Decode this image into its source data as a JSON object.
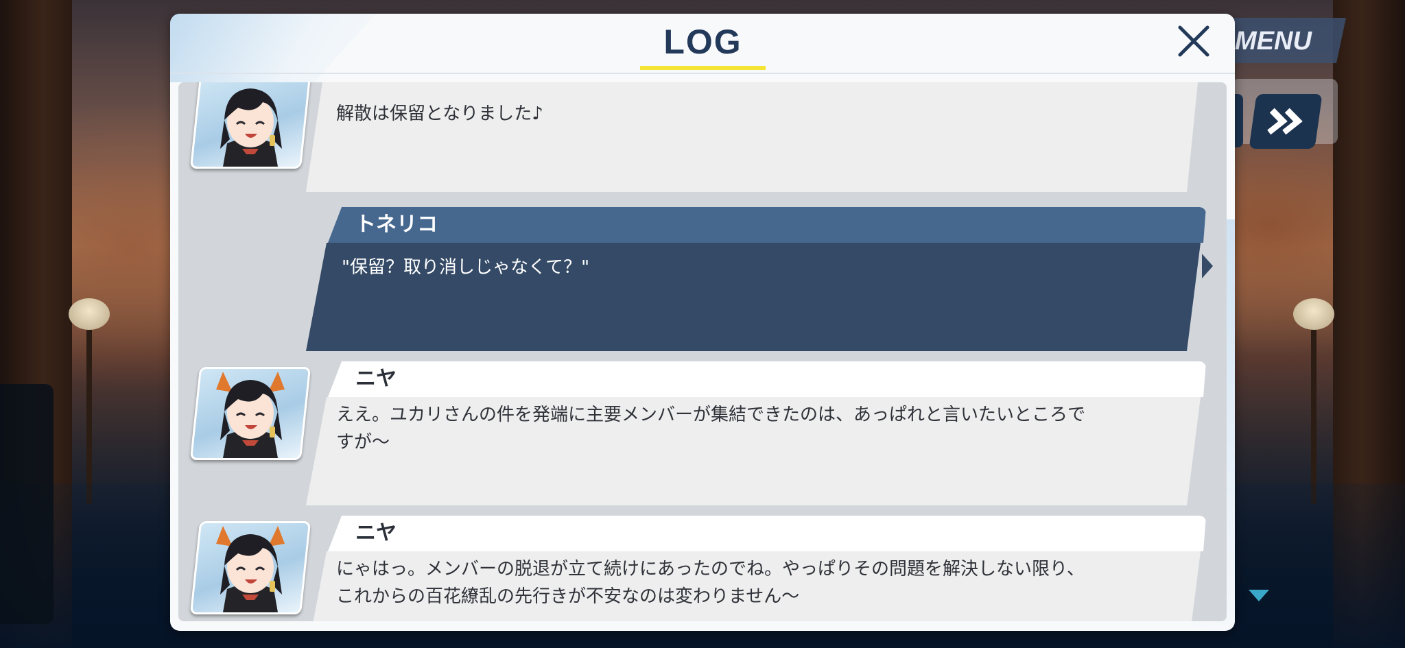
{
  "menu": {
    "label": "MENU"
  },
  "log": {
    "title": "LOG",
    "entries": [
      {
        "speaker": "",
        "text": "解散は保留となりました♪",
        "has_avatar": true
      },
      {
        "speaker": "トネリコ",
        "text": "\"保留？取り消しじゃなくて？\"",
        "has_avatar": false,
        "selected": true
      },
      {
        "speaker": "ニヤ",
        "text": "ええ。ユカリさんの件を発端に主要メンバーが集結できたのは、あっぱれと言いたいところで\nすが～",
        "has_avatar": true
      },
      {
        "speaker": "ニヤ",
        "text": "にゃはっ。メンバーの脱退が立て続けにあったのでね。やっぱりその問題を解決しない限り、\nこれからの百花繚乱の先行きが不安なのは変わりません～",
        "has_avatar": true
      }
    ]
  },
  "icons": {
    "close": "close-icon",
    "fast_forward": "fast-forward-icon",
    "scroll_down": "triangle-down-icon",
    "avatar": "character-portrait-icon"
  },
  "colors": {
    "title_text": "#23395a",
    "title_underline": "#f4e434",
    "selected_bubble": "#344a66",
    "selected_name_bar": "#46688f",
    "bubble": "#eeeeee",
    "control_button": "#1c3350"
  }
}
